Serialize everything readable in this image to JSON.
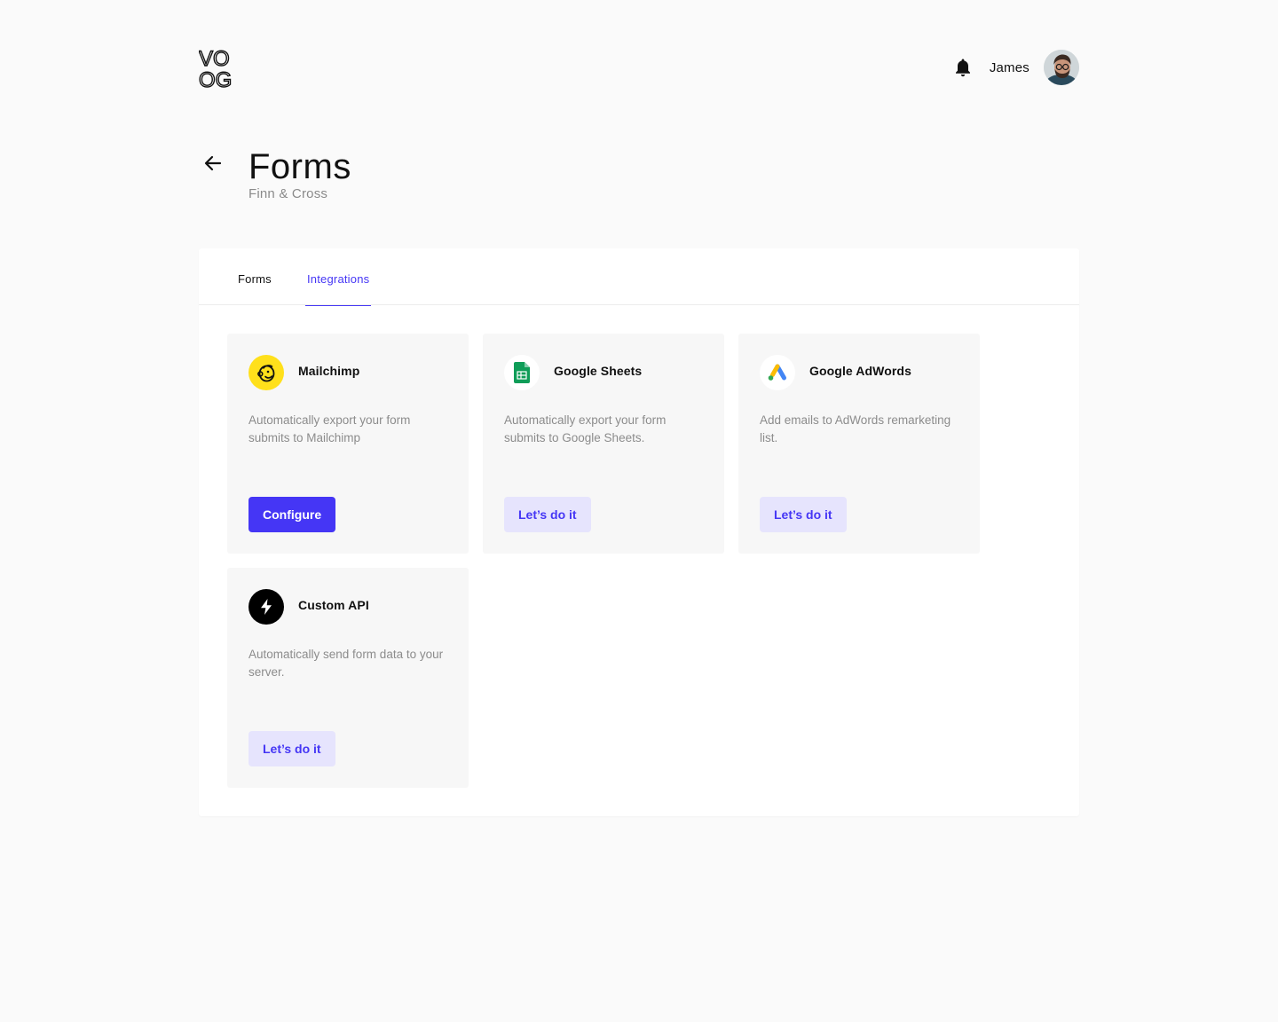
{
  "app": {
    "logo_name": "VOOG",
    "logo_top": "VO",
    "logo_bottom": "OG"
  },
  "header": {
    "user_name": "James"
  },
  "page": {
    "title": "Forms",
    "subtitle": "Finn & Cross"
  },
  "tabs": [
    {
      "label": "Forms",
      "active": false
    },
    {
      "label": "Integrations",
      "active": true
    }
  ],
  "integrations": [
    {
      "name": "Mailchimp",
      "description": "Automatically export your form submits to Mailchimp",
      "button": "Configure",
      "icon": "mailchimp-icon",
      "icon_bg": "#ffe01b"
    },
    {
      "name": "Google Sheets",
      "description": "Automatically export your form submits to Google Sheets.",
      "button": "Let’s do it",
      "icon": "google-sheets-icon",
      "icon_bg": "#ffffff"
    },
    {
      "name": "Google AdWords",
      "description": "Add emails to AdWords remarketing list.",
      "button": "Let’s do it",
      "icon": "google-adwords-icon",
      "icon_bg": "#ffffff"
    },
    {
      "name": "Custom API",
      "description": "Automatically send form data to your server.",
      "button": "Let’s do it",
      "icon": "lightning-icon",
      "icon_bg": "#000000"
    }
  ],
  "colors": {
    "accent": "#4536f5",
    "accent_light": "#e6e4fd",
    "background": "#fafafa",
    "card_bg": "#f7f7f7"
  }
}
